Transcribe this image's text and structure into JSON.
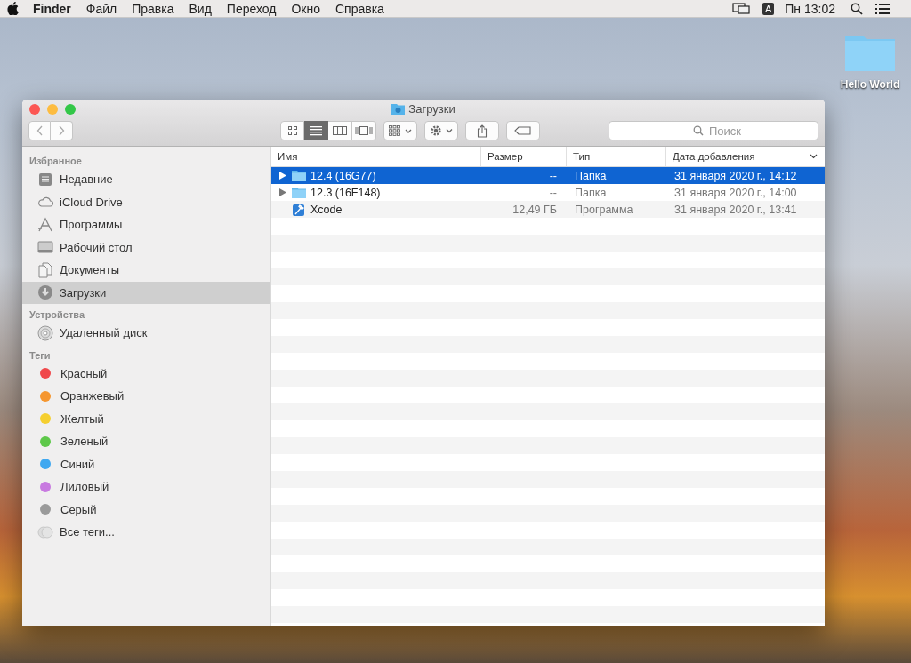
{
  "menubar": {
    "app": "Finder",
    "items": [
      "Файл",
      "Правка",
      "Вид",
      "Переход",
      "Окно",
      "Справка"
    ],
    "input_source": "A",
    "clock": "Пн 13:02"
  },
  "desktop_icons": [
    {
      "label": "Hello World"
    }
  ],
  "window": {
    "title": "Загрузки",
    "view_buttons": [
      {
        "kind": "icons",
        "selected": false
      },
      {
        "kind": "list",
        "selected": true
      },
      {
        "kind": "columns",
        "selected": false
      },
      {
        "kind": "gallery",
        "selected": false
      }
    ],
    "search": {
      "placeholder": "Поиск"
    }
  },
  "sidebar": {
    "sections": [
      {
        "heading": "Избранное",
        "items": [
          {
            "kind": "recent",
            "label": "Недавние",
            "selected": false
          },
          {
            "kind": "cloud",
            "label": "iCloud Drive",
            "selected": false
          },
          {
            "kind": "apps",
            "label": "Программы",
            "selected": false
          },
          {
            "kind": "desktop",
            "label": "Рабочий стол",
            "selected": false
          },
          {
            "kind": "documents",
            "label": "Документы",
            "selected": false
          },
          {
            "kind": "downloads",
            "label": "Загрузки",
            "selected": true
          }
        ]
      },
      {
        "heading": "Устройства",
        "items": [
          {
            "kind": "disk",
            "label": "Удаленный диск",
            "selected": false
          }
        ]
      },
      {
        "heading": "Теги",
        "items": [
          {
            "kind": "tag",
            "label": "Красный",
            "color": "#f0484b",
            "selected": false
          },
          {
            "kind": "tag",
            "label": "Оранжевый",
            "color": "#f5962f",
            "selected": false
          },
          {
            "kind": "tag",
            "label": "Желтый",
            "color": "#f5cf2f",
            "selected": false
          },
          {
            "kind": "tag",
            "label": "Зеленый",
            "color": "#5ec84a",
            "selected": false
          },
          {
            "kind": "tag",
            "label": "Синий",
            "color": "#40a8f0",
            "selected": false
          },
          {
            "kind": "tag",
            "label": "Лиловый",
            "color": "#c87ae0",
            "selected": false
          },
          {
            "kind": "tag",
            "label": "Серый",
            "color": "#9a9a9a",
            "selected": false
          },
          {
            "kind": "all-tags",
            "label": "Все теги...",
            "selected": false
          }
        ]
      }
    ]
  },
  "table": {
    "columns": [
      {
        "label": "Имя",
        "sorted": false
      },
      {
        "label": "Размер",
        "sorted": false
      },
      {
        "label": "Тип",
        "sorted": false
      },
      {
        "label": "Дата добавления",
        "sorted": true
      }
    ],
    "rows": [
      {
        "kind": "folder",
        "expandable": true,
        "selected": true,
        "name": "12.4 (16G77)",
        "size": "--",
        "type": "Папка",
        "date": "31 января 2020 г., 14:12"
      },
      {
        "kind": "folder",
        "expandable": true,
        "selected": false,
        "name": "12.3 (16F148)",
        "size": "--",
        "type": "Папка",
        "date": "31 января 2020 г., 14:00"
      },
      {
        "kind": "app",
        "expandable": false,
        "selected": false,
        "name": "Xcode",
        "size": "12,49 ГБ",
        "type": "Программа",
        "date": "31 января 2020 г., 13:41"
      }
    ]
  }
}
